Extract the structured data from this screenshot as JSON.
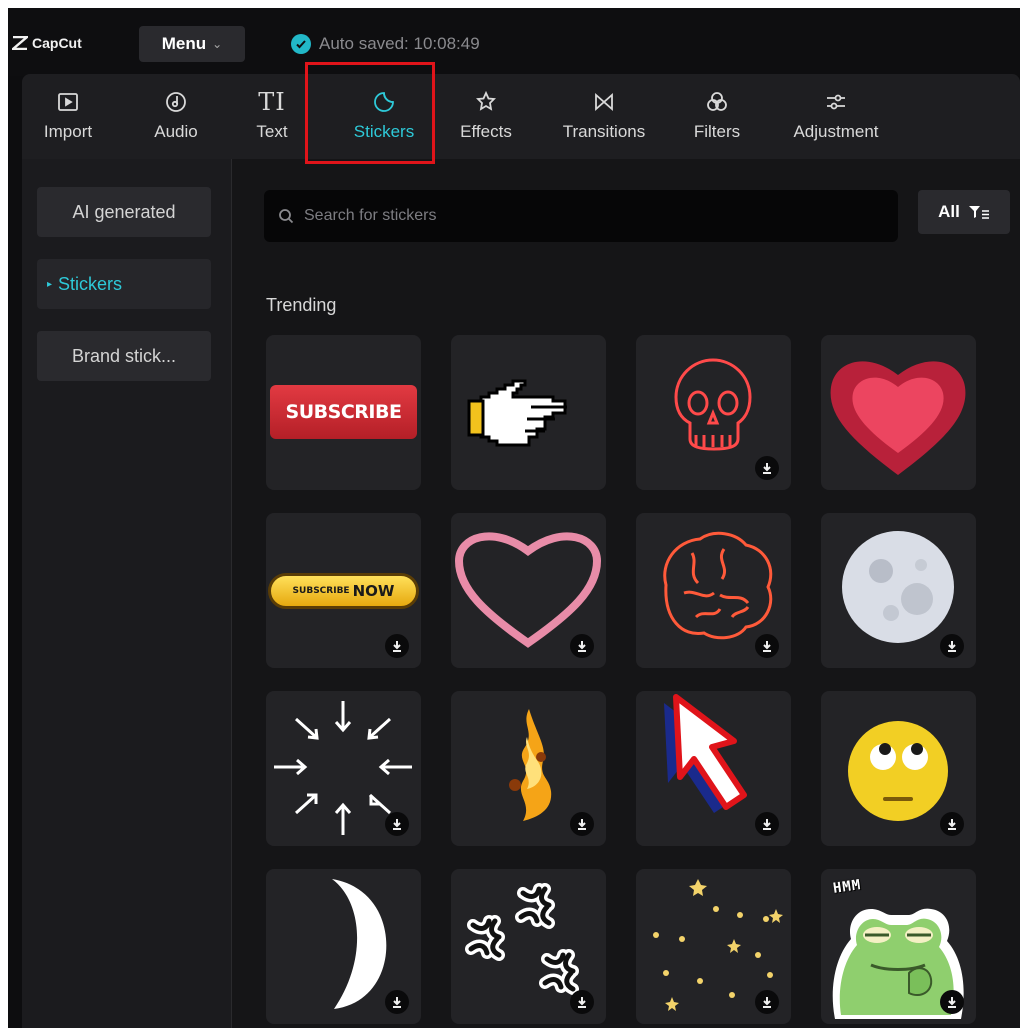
{
  "app": {
    "brand": "CapCut",
    "menu_label": "Menu",
    "autosave_text": "Auto saved: 10:08:49"
  },
  "toolbar": {
    "tools": [
      {
        "label": "Import",
        "icon": "import-icon"
      },
      {
        "label": "Audio",
        "icon": "audio-icon"
      },
      {
        "label": "Text",
        "icon": "text-icon",
        "glyph": "TI"
      },
      {
        "label": "Stickers",
        "icon": "stickers-icon",
        "active": true
      },
      {
        "label": "Effects",
        "icon": "effects-icon"
      },
      {
        "label": "Transitions",
        "icon": "transitions-icon"
      },
      {
        "label": "Filters",
        "icon": "filters-icon"
      },
      {
        "label": "Adjustment",
        "icon": "adjustment-icon"
      }
    ]
  },
  "sidebar": {
    "items": [
      {
        "label": "AI generated"
      },
      {
        "label": "Stickers",
        "active": true
      },
      {
        "label": "Brand stick..."
      }
    ]
  },
  "search": {
    "placeholder": "Search for stickers"
  },
  "filter": {
    "label": "All"
  },
  "section": {
    "title": "Trending"
  },
  "stickers": [
    {
      "name": "subscribe-button",
      "text": "SUBSCRIBE",
      "download": false
    },
    {
      "name": "pixel-pointing-hand",
      "download": false
    },
    {
      "name": "neon-skull",
      "download": true
    },
    {
      "name": "glowing-heart",
      "download": false
    },
    {
      "name": "subscribe-now-button",
      "text_small": "SUBSCRIBE",
      "text_big": "NOW",
      "download": true
    },
    {
      "name": "pink-outline-heart",
      "download": true
    },
    {
      "name": "neon-brain",
      "download": true
    },
    {
      "name": "full-moon",
      "download": true
    },
    {
      "name": "arrows-burst",
      "download": true
    },
    {
      "name": "fire-explosion",
      "download": true
    },
    {
      "name": "red-cursor-arrow",
      "download": true
    },
    {
      "name": "rolling-eyes-emoji",
      "download": true
    },
    {
      "name": "crescent-moon",
      "download": true
    },
    {
      "name": "anger-symbols",
      "download": true
    },
    {
      "name": "gold-stars",
      "download": true
    },
    {
      "name": "hmm-frog",
      "text": "HMM",
      "download": true
    }
  ],
  "colors": {
    "accent": "#2ec9d8",
    "highlight_box": "#e0141a",
    "panel_bg": "#1e1e21"
  }
}
